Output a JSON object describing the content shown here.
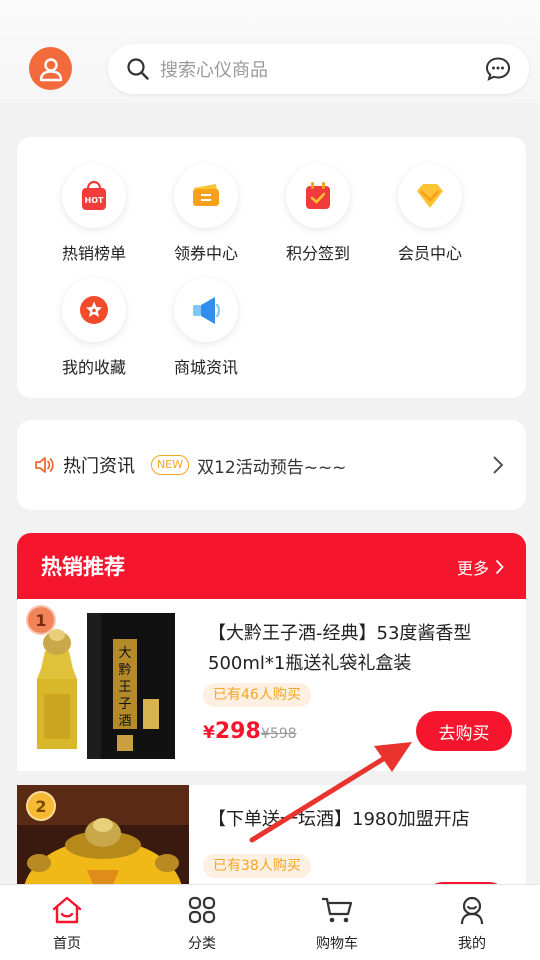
{
  "search": {
    "placeholder": "搜索心仪商品"
  },
  "quick": [
    {
      "label": "热销榜单",
      "icon": "hot-bag-icon",
      "badge": "HOT"
    },
    {
      "label": "领券中心",
      "icon": "coupon-icon"
    },
    {
      "label": "积分签到",
      "icon": "calendar-check-icon"
    },
    {
      "label": "会员中心",
      "icon": "diamond-icon"
    },
    {
      "label": "我的收藏",
      "icon": "star-icon"
    },
    {
      "label": "商城资讯",
      "icon": "megaphone-icon"
    }
  ],
  "news": {
    "title": "热门资讯",
    "badge": "NEW",
    "text": "双12活动预告~~~"
  },
  "hot": {
    "title": "热销推荐",
    "more": "更多",
    "products": [
      {
        "rank": "1",
        "name": "【大黔王子酒-经典】53度酱香型500ml*1瓶送礼袋礼盒装",
        "sold": "已有46人购买",
        "currency": "¥",
        "price": "298",
        "old_price": "¥598",
        "buy": "去购买",
        "box_text": "大黔王子酒"
      },
      {
        "rank": "2",
        "name": "【下单送一坛酒】1980加盟开店",
        "sold": "已有38人购买"
      }
    ]
  },
  "tabs": [
    {
      "label": "首页",
      "icon": "home-icon"
    },
    {
      "label": "分类",
      "icon": "category-icon"
    },
    {
      "label": "购物车",
      "icon": "cart-icon"
    },
    {
      "label": "我的",
      "icon": "profile-icon"
    }
  ],
  "colors": {
    "accent": "#f5152d",
    "avatar": "#f36a3d",
    "gold": "#f5a623"
  }
}
